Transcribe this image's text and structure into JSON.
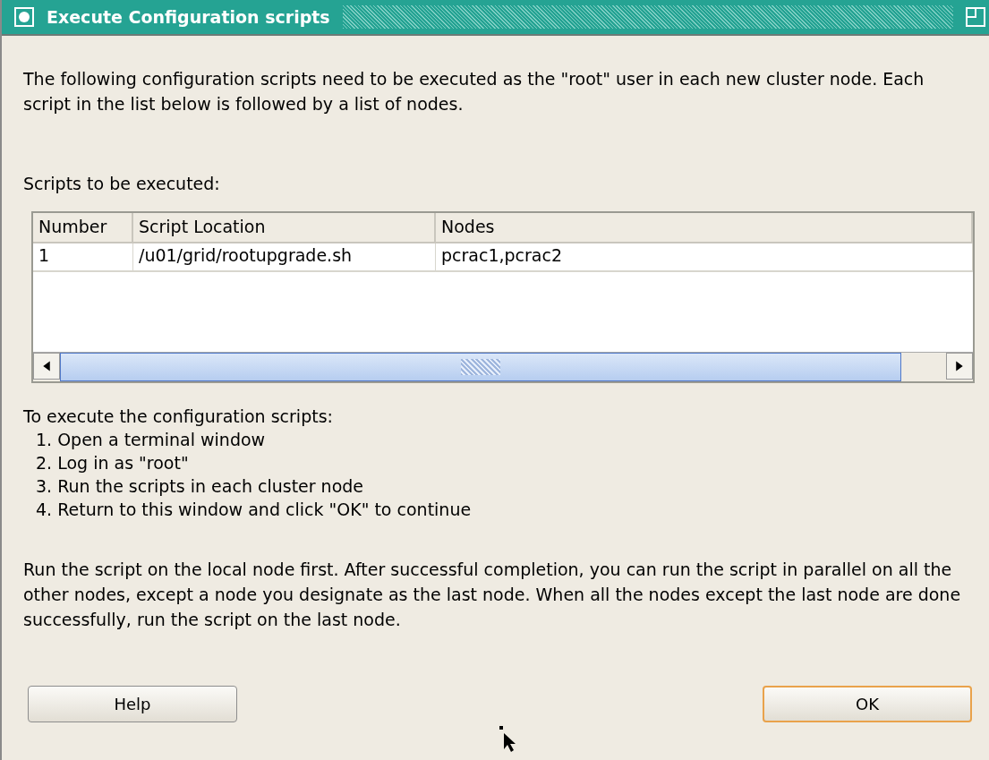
{
  "window": {
    "title": "Execute Configuration scripts"
  },
  "intro": "The following configuration scripts need to be executed as the \"root\" user in each new cluster node. Each script in the list below is followed by a list of nodes.",
  "scripts_label": "Scripts to be executed:",
  "table": {
    "columns": [
      "Number",
      "Script Location",
      "Nodes"
    ],
    "rows": [
      [
        "1",
        "/u01/grid/rootupgrade.sh",
        "pcrac1,pcrac2"
      ]
    ]
  },
  "steps_heading": "To execute the configuration scripts:",
  "steps": [
    "1. Open a terminal window",
    "2. Log in as \"root\"",
    "3. Run the scripts in each cluster node",
    "4. Return to this window and click \"OK\" to continue"
  ],
  "note": "Run the script on the local node first. After successful completion, you can run the script in parallel on all the other nodes, except a node you designate as the last node. When all the nodes except the last node are done successfully, run the script on the last node.",
  "buttons": [
    {
      "label": "Help",
      "kind": "plain"
    },
    {
      "label": "OK",
      "kind": "default"
    }
  ]
}
